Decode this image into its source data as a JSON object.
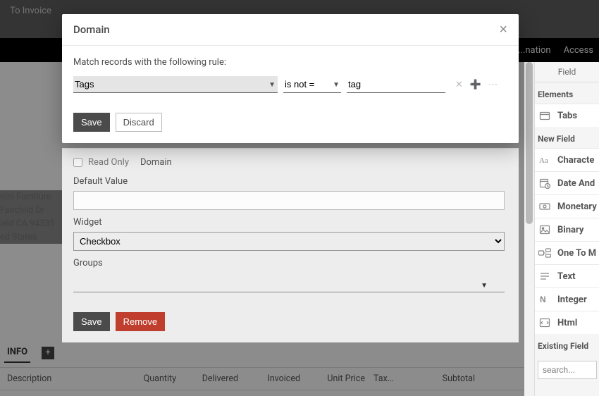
{
  "topbar": {
    "crumb": "To Invoice"
  },
  "navbar": {
    "item1": "...nation",
    "item2": "Access"
  },
  "modal": {
    "title": "Domain",
    "rule_intro": "Match records with the following rule:",
    "field_value": "Tags",
    "op_value": "is not =",
    "value_value": "tag",
    "save_label": "Save",
    "discard_label": "Discard"
  },
  "under": {
    "readonly_label": "Read Only",
    "domain_label": "Domain",
    "default_value_label": "Default Value",
    "default_value": "",
    "widget_label": "Widget",
    "widget_value": "Checkbox",
    "groups_label": "Groups",
    "groups_value": "",
    "save_label": "Save",
    "remove_label": "Remove"
  },
  "side": {
    "header": "Field",
    "elements_title": "Elements",
    "tabs_label": "Tabs",
    "newfield_title": "New Field",
    "items": {
      "char": "Characte",
      "date": "Date And",
      "mon": "Monetary",
      "bin": "Binary",
      "o2m": "One To M",
      "text": "Text",
      "int": "Integer",
      "html": "Html"
    },
    "existing_title": "Existing Field",
    "search_placeholder": "search..."
  },
  "bgAddress": {
    "l1": "nini Furniture",
    "l2": "Fairchild Dr",
    "l3": "ield CA 94535",
    "l4": "ed States"
  },
  "info": {
    "tab_label": "INFO",
    "columns": {
      "desc": "Description",
      "qty": "Quantity",
      "del": "Delivered",
      "inv": "Invoiced",
      "up": "Unit Price",
      "tax": "Tax…",
      "sub": "Subtotal"
    }
  }
}
